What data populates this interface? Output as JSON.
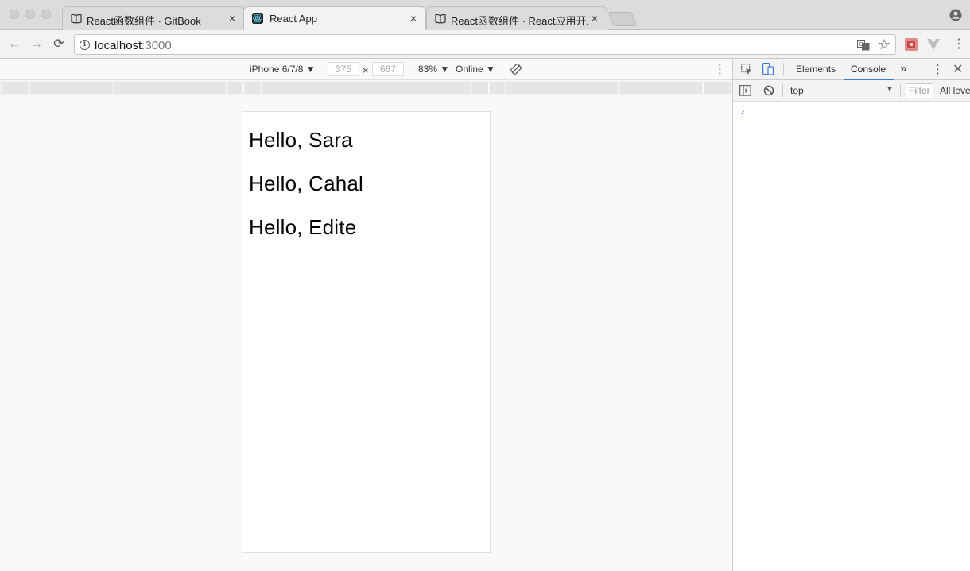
{
  "browser": {
    "tabs": [
      {
        "label": "React函数组件 · GitBook",
        "close": "×"
      },
      {
        "label": "React App",
        "close": "×"
      },
      {
        "label": "React函数组件 · React应用开发",
        "close": "×"
      }
    ],
    "address": {
      "host": "localhost",
      "port": ":3000"
    },
    "nav": {
      "back": "←",
      "forward": "→",
      "reload": "⟳"
    }
  },
  "device_toolbar": {
    "device": "iPhone 6/7/8 ▼",
    "width": "375",
    "times": "×",
    "height": "667",
    "zoom": "83% ▼",
    "network": "Online ▼"
  },
  "page": {
    "greetings": [
      "Hello, Sara",
      "Hello, Cahal",
      "Hello, Edite"
    ]
  },
  "devtools": {
    "tabs": [
      "Elements",
      "Console"
    ],
    "active_tab": "Console",
    "more": "»",
    "context": "top",
    "filter_placeholder": "Filter",
    "levels": "All levels",
    "prompt": "›"
  },
  "colors": {
    "accent": "#3879d9",
    "react_icon": "#61dafb"
  }
}
